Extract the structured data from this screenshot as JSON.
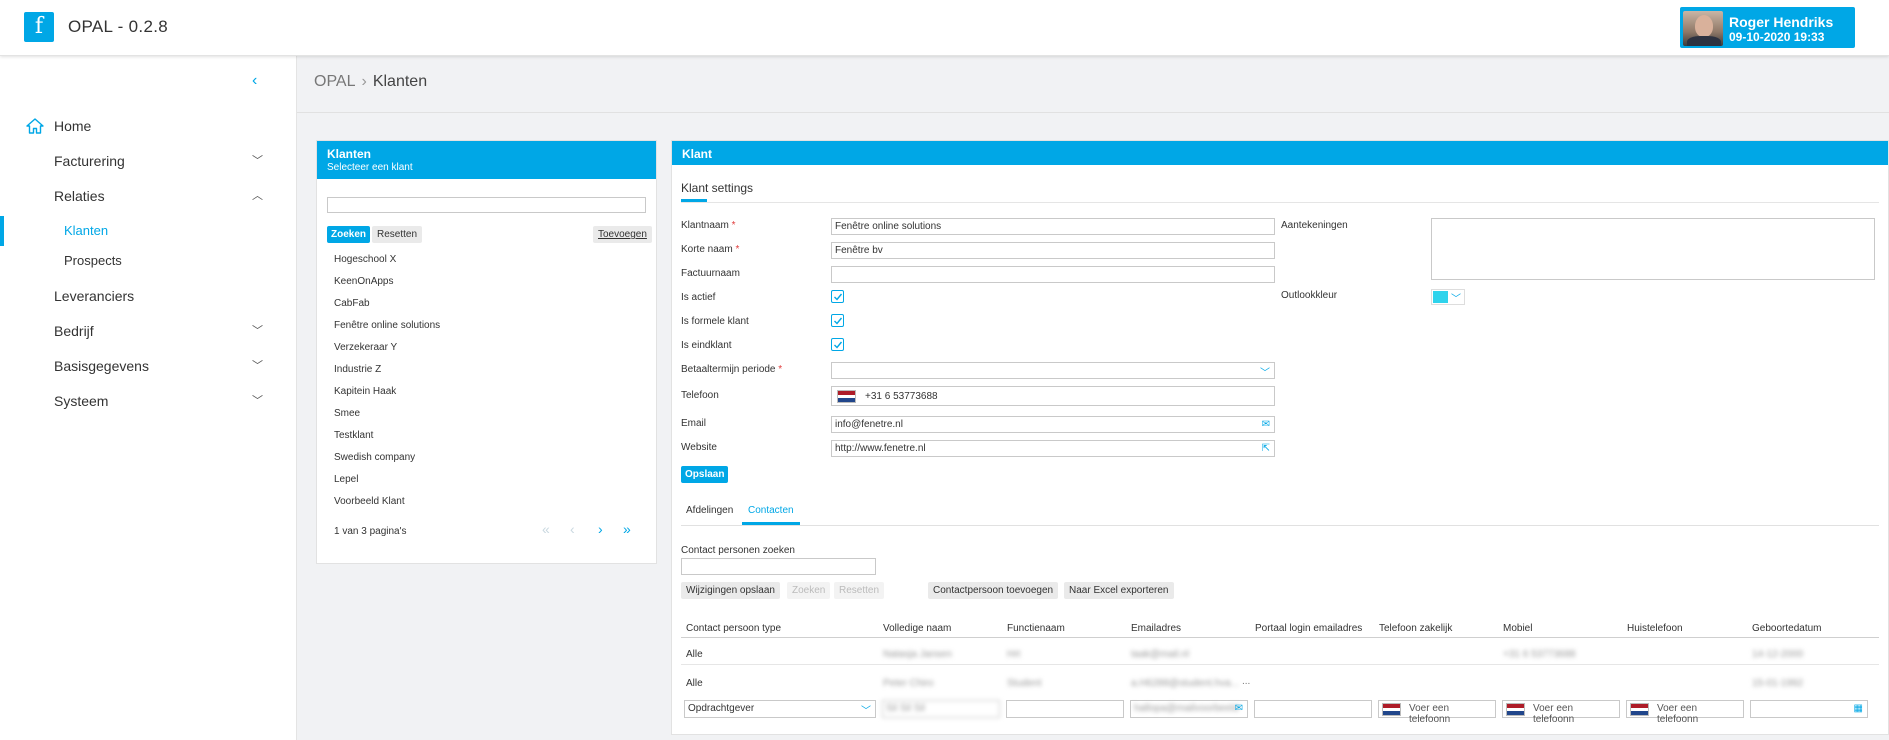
{
  "app": {
    "logo": "f",
    "title": "OPAL - 0.2.8"
  },
  "user": {
    "name": "Roger Hendriks",
    "datetime": "09-10-2020 19:33"
  },
  "sidebar": {
    "collapse_icon": "chevron-left-icon",
    "items": [
      {
        "label": "Home",
        "icon": "home-icon"
      },
      {
        "label": "Facturering",
        "chevron": "chevron-down-icon"
      },
      {
        "label": "Relaties",
        "chevron": "chevron-up-icon"
      },
      {
        "label": "Klanten"
      },
      {
        "label": "Prospects"
      },
      {
        "label": "Leveranciers"
      },
      {
        "label": "Bedrijf",
        "chevron": "chevron-down-icon"
      },
      {
        "label": "Basisgegevens",
        "chevron": "chevron-down-icon"
      },
      {
        "label": "Systeem",
        "chevron": "chevron-down-icon"
      }
    ],
    "active_item": "Klanten",
    "accent_color": "#00a7e6"
  },
  "breadcrumb": {
    "root": "OPAL",
    "separator": "›",
    "current": "Klanten"
  },
  "klanten_panel": {
    "title": "Klanten",
    "subtitle": "Selecteer een klant",
    "search_value": "",
    "buttons": {
      "search": "Zoeken",
      "reset": "Resetten",
      "add": "Toevoegen"
    },
    "items": [
      "Hogeschool X",
      "KeenOnApps",
      "CabFab",
      "Fenêtre online solutions",
      "Verzekeraar Y",
      "Industrie Z",
      "Kapitein Haak",
      "Smee",
      "Testklant",
      "Swedish company",
      "Lepel",
      "Voorbeeld Klant"
    ],
    "pagination": {
      "text": "1 van 3 pagina's",
      "first": "«",
      "prev": "‹",
      "next": "›",
      "last": "»"
    }
  },
  "klant_panel": {
    "title": "Klant",
    "section_title": "Klant settings",
    "fields": {
      "klantnaam": {
        "label": "Klantnaam",
        "value": "Fenêtre online solutions",
        "required": "*"
      },
      "korte_naam": {
        "label": "Korte naam",
        "value": "Fenêtre bv",
        "required": "*"
      },
      "factuurnaam": {
        "label": "Factuurnaam",
        "value": ""
      },
      "is_actief": {
        "label": "Is actief",
        "checked": true
      },
      "is_formele_klant": {
        "label": "Is formele klant",
        "checked": true
      },
      "is_eindklant": {
        "label": "Is eindklant",
        "checked": true
      },
      "betaaltermijn": {
        "label": "Betaaltermijn periode",
        "value": "",
        "required": "*"
      },
      "telefoon": {
        "label": "Telefoon",
        "value": "+31 6 53773688"
      },
      "email": {
        "label": "Email",
        "value": "info@fenetre.nl",
        "icon": "envelope-icon"
      },
      "website": {
        "label": "Website",
        "value": "http://www.fenetre.nl",
        "icon": "external-link-icon"
      },
      "aantekeningen": {
        "label": "Aantekeningen",
        "value": ""
      },
      "outlookkleur": {
        "label": "Outlookkleur",
        "color": "#2fd3ec"
      }
    },
    "save_button": "Opslaan",
    "tabs": [
      "Afdelingen",
      "Contacten"
    ],
    "active_tab": "Contacten",
    "contacts": {
      "search_label": "Contact personen zoeken",
      "search_value": "",
      "buttons": {
        "save_changes": "Wijzigingen opslaan",
        "search": "Zoeken",
        "reset": "Resetten",
        "add_contact": "Contactpersoon toevoegen",
        "export": "Naar Excel exporteren"
      },
      "columns": [
        "Contact persoon type",
        "Volledige naam",
        "Functienaam",
        "Emailadres",
        "Portaal login emailadres",
        "Telefoon zakelijk",
        "Mobiel",
        "Huistelefoon",
        "Geboortedatum"
      ],
      "rows": [
        [
          "Alle",
          "Natasja Jansen",
          "Hrt",
          "taak@mail.nl",
          "",
          "",
          "+31 6 53773688",
          "",
          "14-12-2000"
        ],
        [
          "Alle",
          "Peter Chiro",
          "Student",
          "a.H6288@student.hva...",
          "...",
          "",
          "",
          "",
          "15-01-1992"
        ]
      ],
      "new_row": {
        "type": "Opdrachtgever",
        "name": "Sil Sil Sil",
        "function": "",
        "email": "hallopa@mailvoorbeeld",
        "portal": "",
        "phone_placeholder": "Voer een telefoonn"
      }
    }
  }
}
